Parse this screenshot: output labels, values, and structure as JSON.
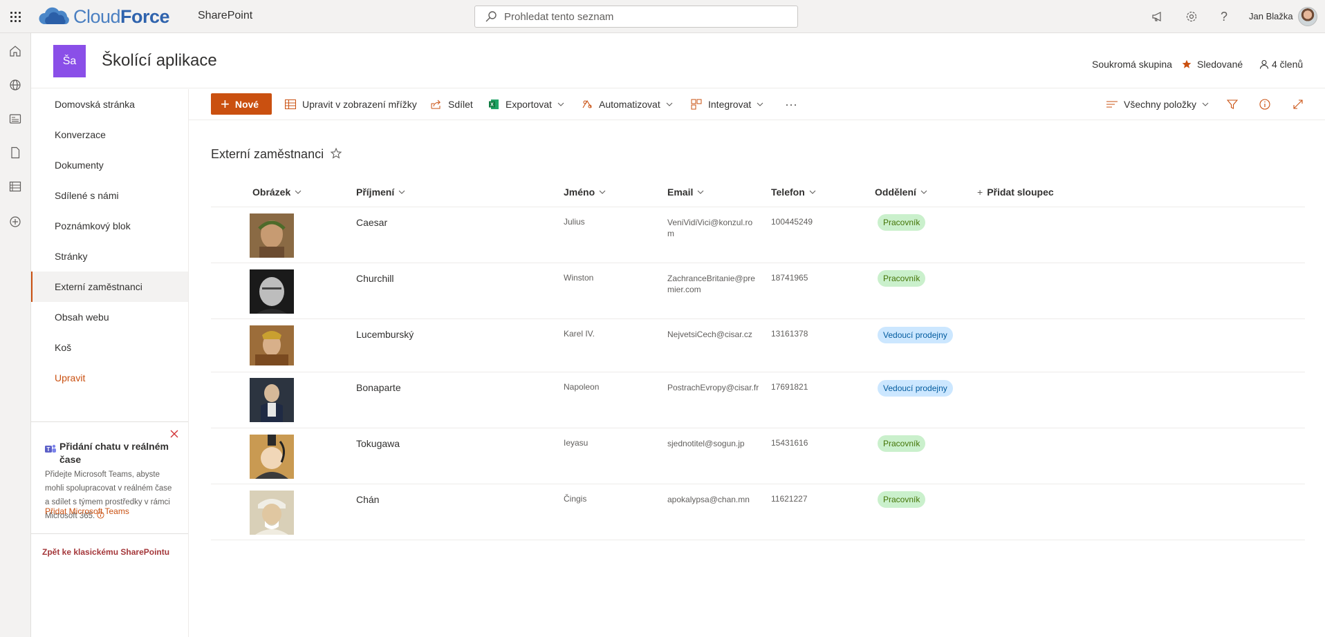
{
  "suitebar": {
    "logo_text_light": "Cloud",
    "logo_text_bold": "Force",
    "app_name": "SharePoint",
    "search_placeholder": "Prohledat tento seznam",
    "user_name": "Jan Blažka",
    "icons": [
      "app-launcher-icon",
      "megaphone-icon",
      "settings-icon",
      "help-icon"
    ]
  },
  "site": {
    "logo_initials": "Ša",
    "title": "Školící aplikace",
    "privacy": "Soukromá skupina",
    "follow_label": "Sledované",
    "members_label": "4 členů"
  },
  "rail": {
    "icons": [
      "home-icon",
      "globe-icon",
      "news-icon",
      "document-icon",
      "list-icon",
      "add-circle-icon"
    ]
  },
  "nav": {
    "items": [
      {
        "label": "Domovská stránka"
      },
      {
        "label": "Konverzace"
      },
      {
        "label": "Dokumenty"
      },
      {
        "label": "Sdílené s námi"
      },
      {
        "label": "Poznámkový blok"
      },
      {
        "label": "Stránky"
      },
      {
        "label": "Externí zaměstnanci",
        "active": true
      },
      {
        "label": "Obsah webu"
      },
      {
        "label": "Koš"
      }
    ],
    "edit_label": "Upravit",
    "teams_card": {
      "title": "Přidání chatu v reálném čase",
      "body": "Přidejte Microsoft Teams, abyste mohli spolupracovat v reálném čase a sdílet s týmem prostředky v rámci Microsoft 365.",
      "link": "Přidat Microsoft Teams"
    },
    "classic_link": "Zpět ke klasickému SharePointu"
  },
  "commandbar": {
    "new_label": "Nové",
    "edit_grid": "Upravit v zobrazení mřížky",
    "share": "Sdílet",
    "export": "Exportovat",
    "automate": "Automatizovat",
    "integrate": "Integrovat",
    "more": "···",
    "view_label": "Všechny položky"
  },
  "list": {
    "title": "Externí zaměstnanci",
    "columns": {
      "image": "Obrázek",
      "surname": "Příjmení",
      "name": "Jméno",
      "email": "Email",
      "phone": "Telefon",
      "department": "Oddělení",
      "add_column": "Přidat sloupec"
    },
    "rows": [
      {
        "surname": "Caesar",
        "name": "Julius",
        "email": "VeniVidiVici@konzul.rom",
        "phone": "100445249",
        "department": "Pracovník",
        "dept_color": "green"
      },
      {
        "surname": "Churchill",
        "name": "Winston",
        "email": "ZachranceBritanie@premier.com",
        "phone": "18741965",
        "department": "Pracovník",
        "dept_color": "green"
      },
      {
        "surname": "Lucemburský",
        "name": "Karel IV.",
        "email": "NejvetsiCech@cisar.cz",
        "phone": "13161378",
        "department": "Vedoucí prodejny",
        "dept_color": "blue"
      },
      {
        "surname": "Bonaparte",
        "name": "Napoleon",
        "email": "PostrachEvropy@cisar.fr",
        "phone": "17691821",
        "department": "Vedoucí prodejny",
        "dept_color": "blue"
      },
      {
        "surname": "Tokugawa",
        "name": "Ieyasu",
        "email": "sjednotitel@sogun.jp",
        "phone": "15431616",
        "department": "Pracovník",
        "dept_color": "green"
      },
      {
        "surname": "Chán",
        "name": "Čingis",
        "email": "apokalypsa@chan.mn",
        "phone": "11621227",
        "department": "Pracovník",
        "dept_color": "green"
      }
    ]
  },
  "colors": {
    "accent": "#ca5010",
    "site_logo": "#8a4fe8",
    "badge_green_bg": "#caf0cc",
    "badge_blue_bg": "#cce7ff"
  }
}
